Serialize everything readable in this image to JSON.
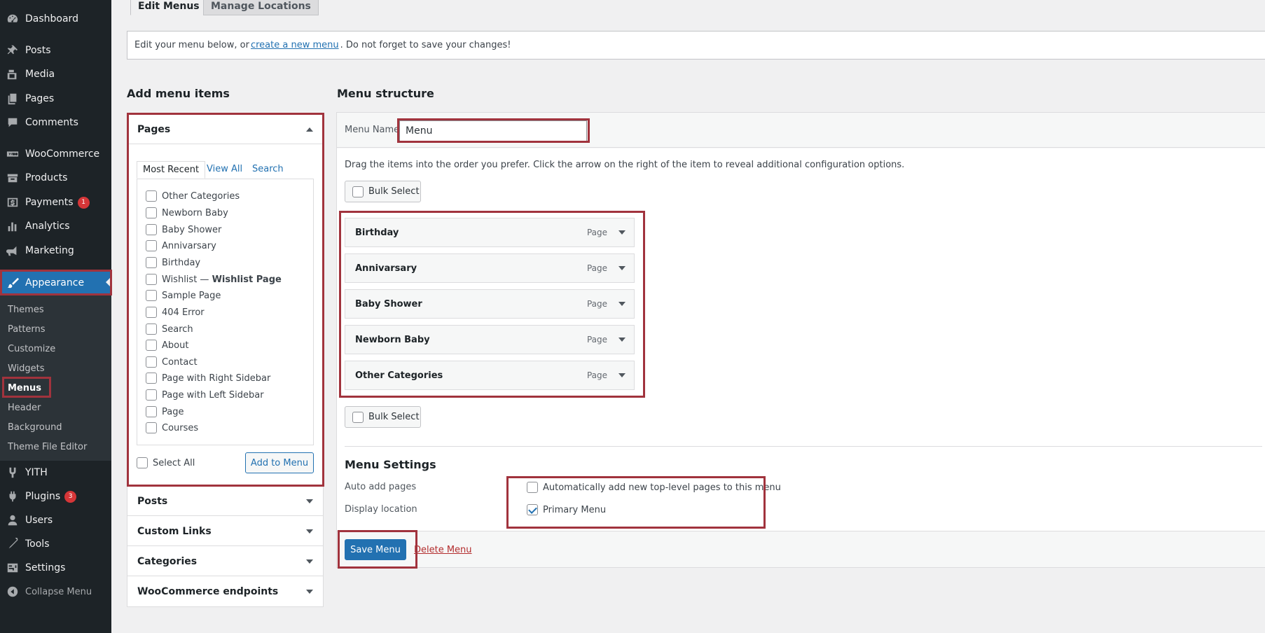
{
  "sidebar": {
    "items": [
      {
        "label": "Dashboard",
        "icon": "dashboard-icon"
      },
      {
        "label": "Posts",
        "icon": "pin-icon"
      },
      {
        "label": "Media",
        "icon": "media-icon"
      },
      {
        "label": "Pages",
        "icon": "pages-icon"
      },
      {
        "label": "Comments",
        "icon": "comments-icon"
      },
      {
        "label": "WooCommerce",
        "icon": "woocommerce-icon"
      },
      {
        "label": "Products",
        "icon": "products-icon"
      },
      {
        "label": "Payments",
        "icon": "payments-icon",
        "badge": "1"
      },
      {
        "label": "Analytics",
        "icon": "analytics-icon"
      },
      {
        "label": "Marketing",
        "icon": "marketing-icon"
      },
      {
        "label": "Appearance",
        "icon": "brush-icon"
      },
      {
        "label": "YITH",
        "icon": "yith-icon"
      },
      {
        "label": "Plugins",
        "icon": "plugins-icon",
        "badge": "3"
      },
      {
        "label": "Users",
        "icon": "users-icon"
      },
      {
        "label": "Tools",
        "icon": "tools-icon"
      },
      {
        "label": "Settings",
        "icon": "settings-icon"
      }
    ],
    "submenu": [
      "Themes",
      "Patterns",
      "Customize",
      "Widgets",
      "Menus",
      "Header",
      "Background",
      "Theme File Editor"
    ],
    "collapse_label": "Collapse Menu"
  },
  "tabs": {
    "edit": "Edit Menus",
    "manage": "Manage Locations"
  },
  "notice": {
    "before": "Edit your menu below, or",
    "link": "create a new menu",
    "after": ". Do not forget to save your changes!"
  },
  "add_items": {
    "title": "Add menu items",
    "pages_title": "Pages",
    "inner_tabs": [
      "Most Recent",
      "View All",
      "Search"
    ],
    "pages": [
      "Other Categories",
      "Newborn Baby",
      "Baby Shower",
      "Annivarsary",
      "Birthday",
      "Wishlist —",
      "Sample Page",
      "404 Error",
      "Search",
      "About",
      "Contact",
      "Page with Right Sidebar",
      "Page with Left Sidebar",
      "Page",
      "Courses"
    ],
    "wishlist_suffix": "Wishlist Page",
    "select_all": "Select All",
    "add_button": "Add to Menu",
    "other_sections": [
      "Posts",
      "Custom Links",
      "Categories",
      "WooCommerce endpoints"
    ]
  },
  "structure": {
    "title": "Menu structure",
    "menu_name_label": "Menu Name",
    "menu_name_value": "Menu",
    "instructions": "Drag the items into the order you prefer. Click the arrow on the right of the item to reveal additional configuration options.",
    "bulk_select": "Bulk Select",
    "items": [
      {
        "title": "Birthday",
        "type": "Page"
      },
      {
        "title": "Annivarsary",
        "type": "Page"
      },
      {
        "title": "Baby Shower",
        "type": "Page"
      },
      {
        "title": "Newborn Baby",
        "type": "Page"
      },
      {
        "title": "Other Categories",
        "type": "Page"
      }
    ]
  },
  "settings": {
    "title": "Menu Settings",
    "auto_add_label": "Auto add pages",
    "auto_add_text": "Automatically add new top-level pages to this menu",
    "auto_add_checked": false,
    "display_location_label": "Display location",
    "primary_menu_text": "Primary Menu",
    "primary_menu_checked": true
  },
  "footer": {
    "save": "Save Menu",
    "delete": "Delete Menu"
  },
  "colors": {
    "highlight": "#a1333d",
    "primary": "#2271b1",
    "sidebar": "#1d2327"
  }
}
